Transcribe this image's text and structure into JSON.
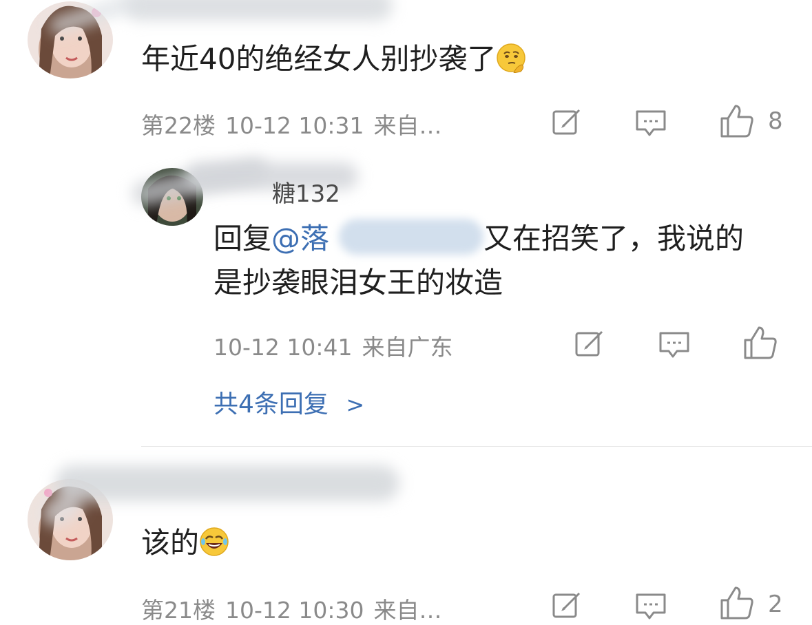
{
  "comments": [
    {
      "text": "年近40的绝经女人别抄袭了",
      "emoji": "thinking-face-emoji",
      "floor": "第22楼",
      "time": "10-12 10:31",
      "source": "来自…",
      "likes": "8"
    },
    {
      "reply": {
        "username_visible": "糖132",
        "reply_prefix": "回复",
        "mention": "@落",
        "text_after": "又在招笑了，我说的",
        "text_line2": "是抄袭眼泪女王的妆造",
        "time": "10-12 10:41",
        "source": "来自广东"
      },
      "more_replies": "共4条回复",
      "more_replies_chevron": ">"
    },
    {
      "text": "该的",
      "emoji": "rolling-laughing-emoji",
      "floor": "第21楼",
      "time": "10-12 10:30",
      "source": "来自…",
      "likes": "2"
    }
  ],
  "colors": {
    "link": "#3d6fb3",
    "meta": "#8a8a8a",
    "text": "#1f1f1f"
  }
}
